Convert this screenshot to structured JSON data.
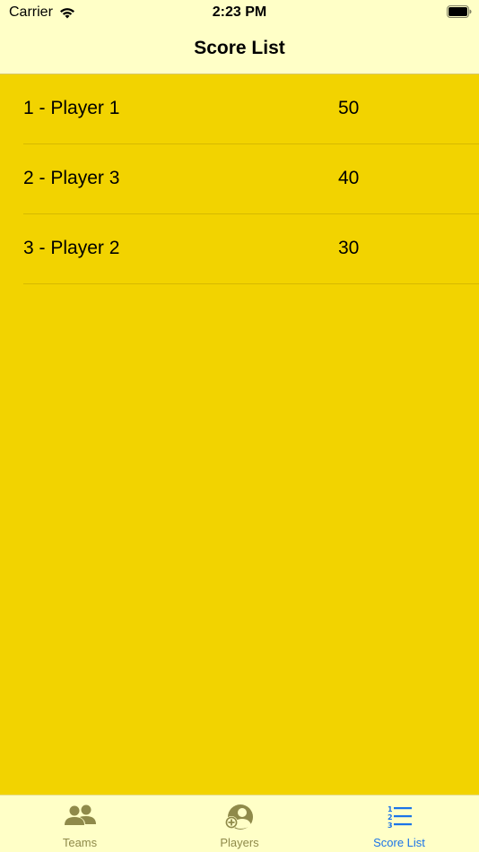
{
  "status_bar": {
    "carrier": "Carrier",
    "time": "2:23 PM"
  },
  "nav": {
    "title": "Score List"
  },
  "scores": [
    {
      "name": "1 - Player 1",
      "score": "50"
    },
    {
      "name": "2 - Player 3",
      "score": "40"
    },
    {
      "name": "3 - Player 2",
      "score": "30"
    }
  ],
  "tabs": [
    {
      "label": "Teams",
      "icon": "teams-icon",
      "active": false
    },
    {
      "label": "Players",
      "icon": "add-player-icon",
      "active": false
    },
    {
      "label": "Score List",
      "icon": "numbered-list-icon",
      "active": true
    }
  ],
  "colors": {
    "background": "#f2d300",
    "bars": "#ffffc7",
    "active_tab": "#1a73e8",
    "inactive_tab": "#8f8a4a"
  }
}
